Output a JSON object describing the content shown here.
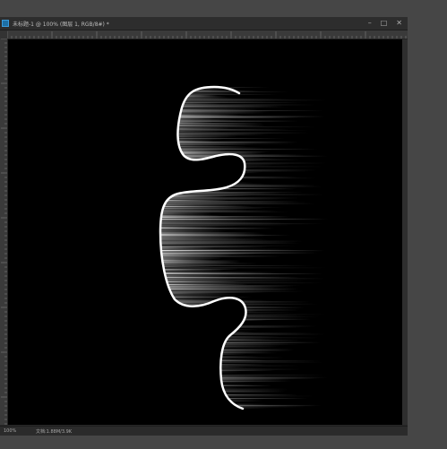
{
  "document": {
    "title": "未标题-1 @ 100% (图层 1, RGB/8#) *",
    "window_controls": [
      "–",
      "□",
      "✕"
    ]
  },
  "status": {
    "zoom": "100%",
    "doc_info": "文档:1.88M/3.9K"
  },
  "colors": {
    "canvas": "#000000",
    "stroke": "#ffffff",
    "panel": "#282828",
    "app_icon": "#1d6fa5"
  },
  "canvas_content": {
    "shape": "puzzle-piece-outline",
    "effect": "horizontal motion streak lines"
  }
}
